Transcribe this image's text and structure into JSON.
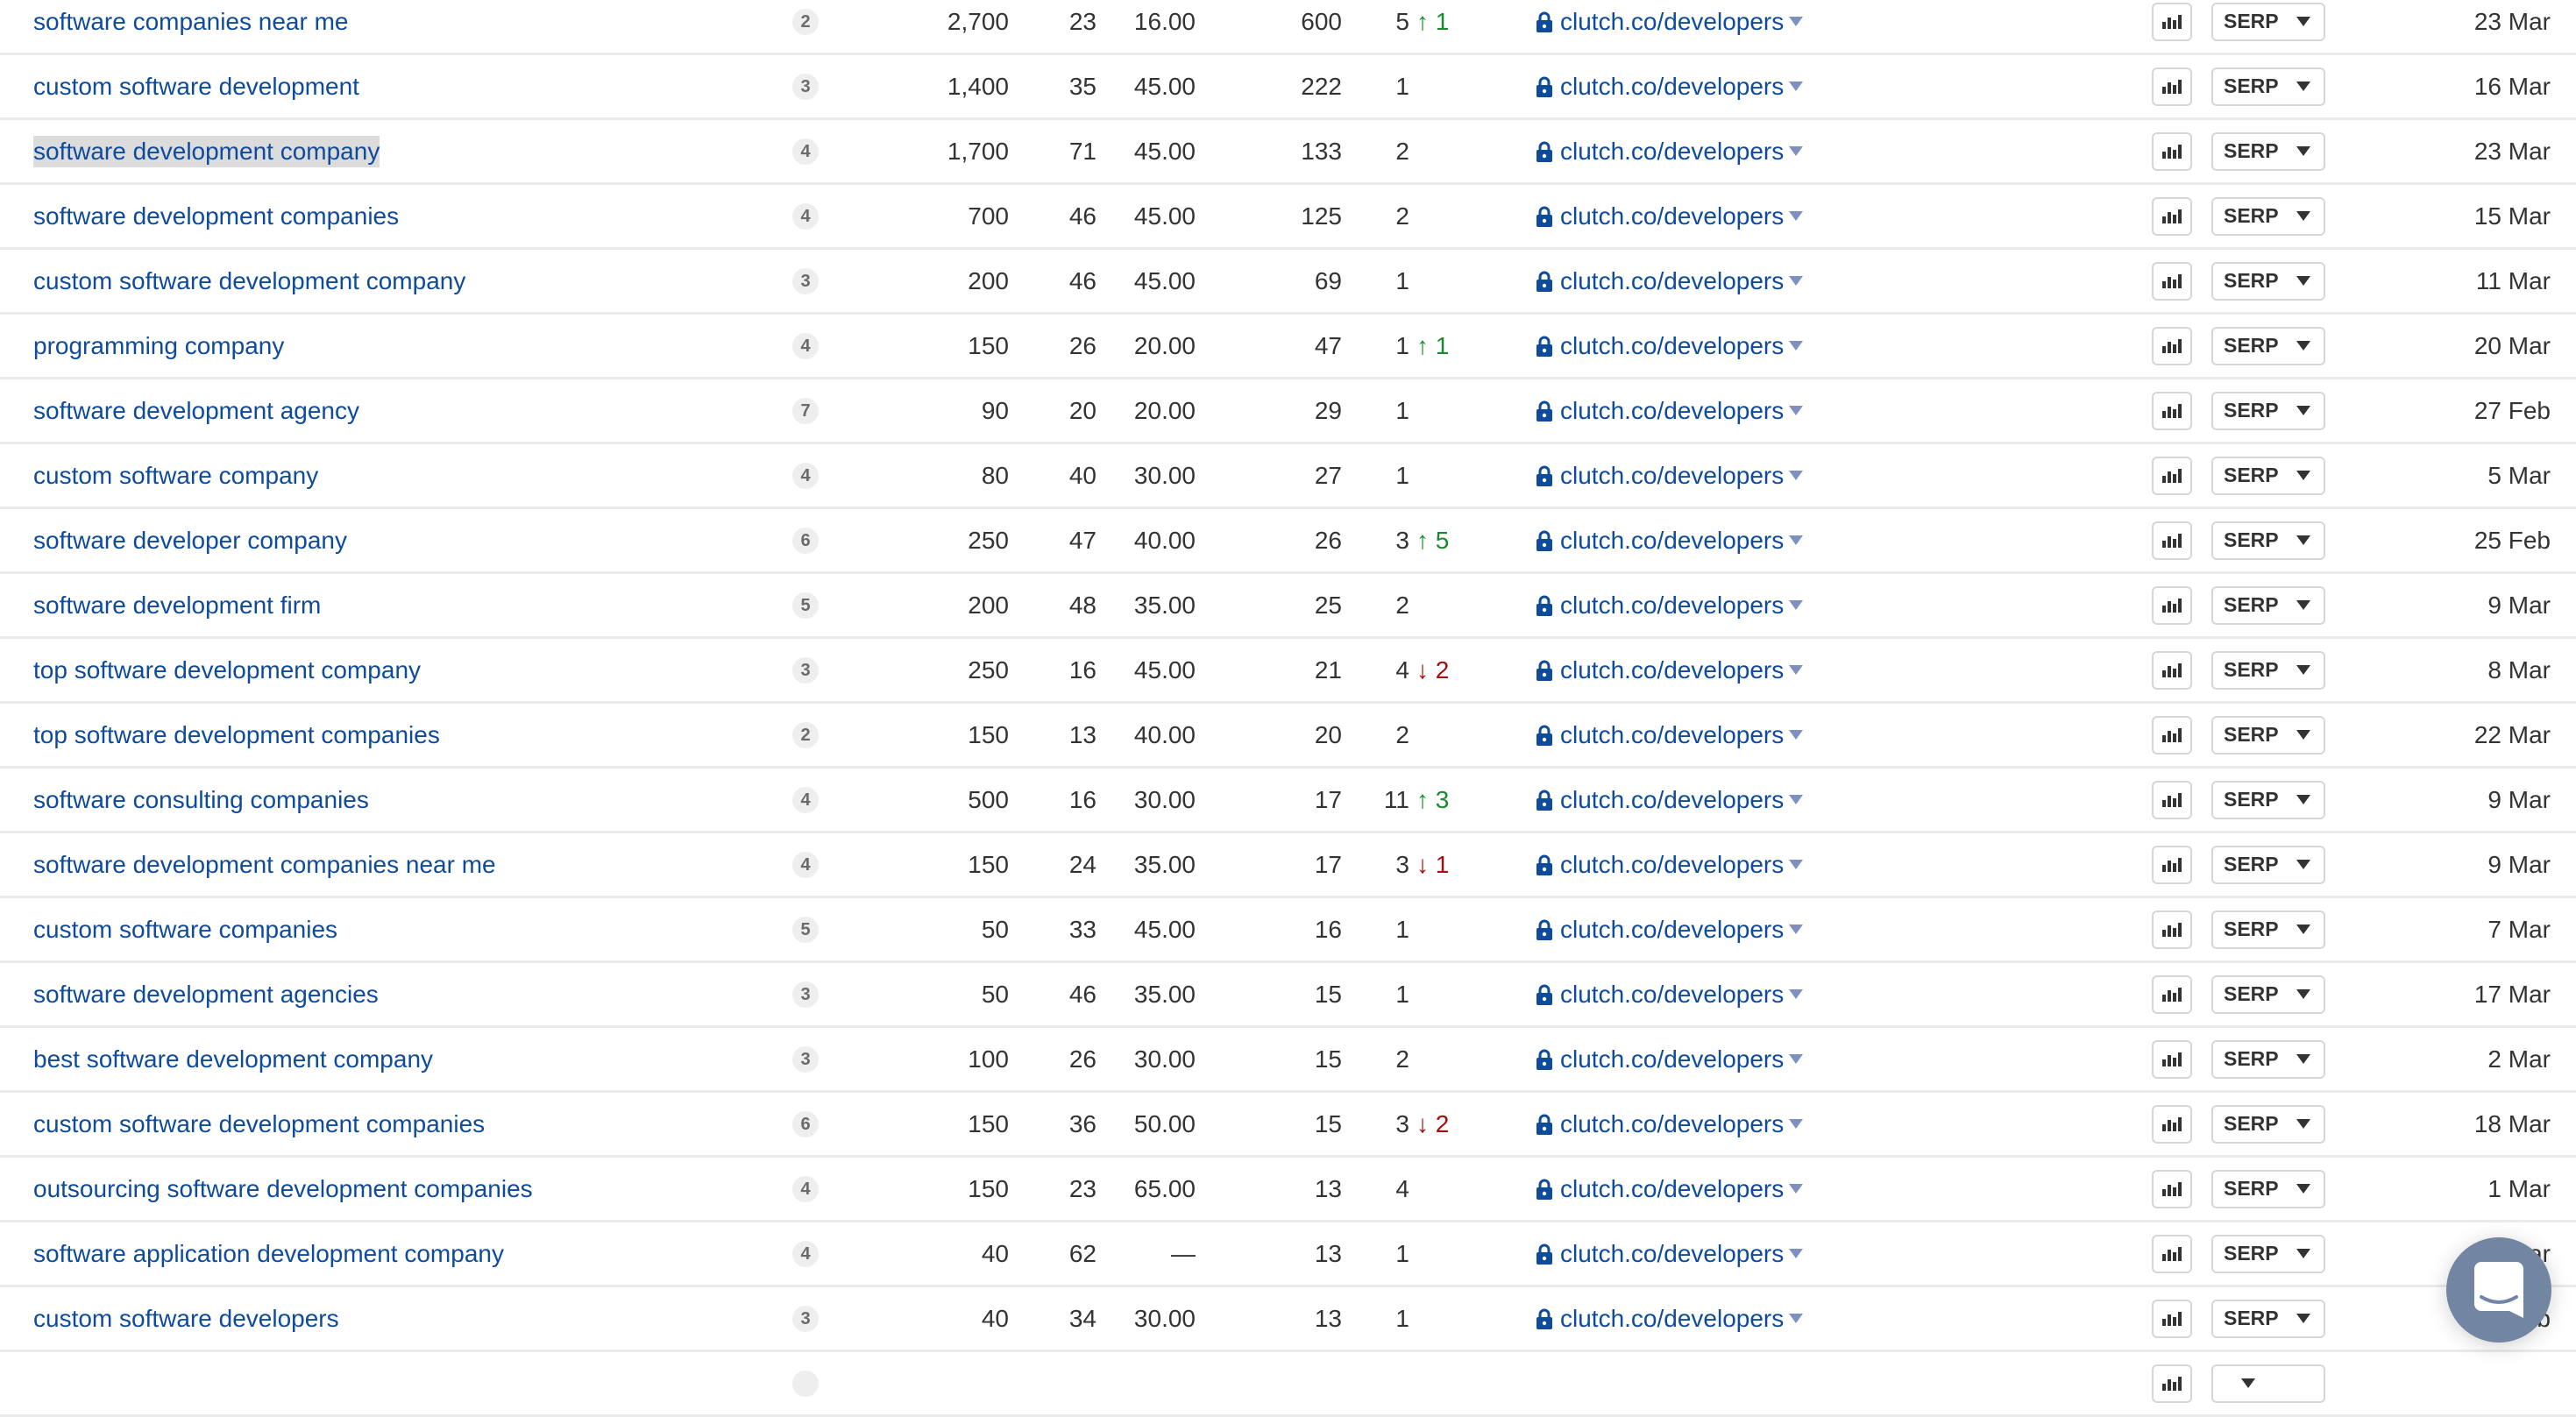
{
  "rows": [
    {
      "keyword": "software companies near me",
      "words": "2",
      "volume": "2,700",
      "kd": "23",
      "cpc": "16.00",
      "traffic": "600",
      "position": "5",
      "change": "1",
      "change_dir": "up",
      "url": "clutch.co/developers",
      "serp_label": "SERP",
      "updated": "23 Mar"
    },
    {
      "keyword": "custom software development",
      "words": "3",
      "volume": "1,400",
      "kd": "35",
      "cpc": "45.00",
      "traffic": "222",
      "position": "1",
      "change": "",
      "change_dir": "",
      "url": "clutch.co/developers",
      "serp_label": "SERP",
      "updated": "16 Mar"
    },
    {
      "keyword": "software development company",
      "words": "4",
      "volume": "1,700",
      "kd": "71",
      "cpc": "45.00",
      "traffic": "133",
      "position": "2",
      "change": "",
      "change_dir": "",
      "url": "clutch.co/developers",
      "serp_label": "SERP",
      "updated": "23 Mar",
      "selected": true
    },
    {
      "keyword": "software development companies",
      "words": "4",
      "volume": "700",
      "kd": "46",
      "cpc": "45.00",
      "traffic": "125",
      "position": "2",
      "change": "",
      "change_dir": "",
      "url": "clutch.co/developers",
      "serp_label": "SERP",
      "updated": "15 Mar"
    },
    {
      "keyword": "custom software development company",
      "words": "3",
      "volume": "200",
      "kd": "46",
      "cpc": "45.00",
      "traffic": "69",
      "position": "1",
      "change": "",
      "change_dir": "",
      "url": "clutch.co/developers",
      "serp_label": "SERP",
      "updated": "11 Mar"
    },
    {
      "keyword": "programming company",
      "words": "4",
      "volume": "150",
      "kd": "26",
      "cpc": "20.00",
      "traffic": "47",
      "position": "1",
      "change": "1",
      "change_dir": "up",
      "url": "clutch.co/developers",
      "serp_label": "SERP",
      "updated": "20 Mar"
    },
    {
      "keyword": "software development agency",
      "words": "7",
      "volume": "90",
      "kd": "20",
      "cpc": "20.00",
      "traffic": "29",
      "position": "1",
      "change": "",
      "change_dir": "",
      "url": "clutch.co/developers",
      "serp_label": "SERP",
      "updated": "27 Feb"
    },
    {
      "keyword": "custom software company",
      "words": "4",
      "volume": "80",
      "kd": "40",
      "cpc": "30.00",
      "traffic": "27",
      "position": "1",
      "change": "",
      "change_dir": "",
      "url": "clutch.co/developers",
      "serp_label": "SERP",
      "updated": "5 Mar"
    },
    {
      "keyword": "software developer company",
      "words": "6",
      "volume": "250",
      "kd": "47",
      "cpc": "40.00",
      "traffic": "26",
      "position": "3",
      "change": "5",
      "change_dir": "up",
      "url": "clutch.co/developers",
      "serp_label": "SERP",
      "updated": "25 Feb"
    },
    {
      "keyword": "software development firm",
      "words": "5",
      "volume": "200",
      "kd": "48",
      "cpc": "35.00",
      "traffic": "25",
      "position": "2",
      "change": "",
      "change_dir": "",
      "url": "clutch.co/developers",
      "serp_label": "SERP",
      "updated": "9 Mar"
    },
    {
      "keyword": "top software development company",
      "words": "3",
      "volume": "250",
      "kd": "16",
      "cpc": "45.00",
      "traffic": "21",
      "position": "4",
      "change": "2",
      "change_dir": "down",
      "url": "clutch.co/developers",
      "serp_label": "SERP",
      "updated": "8 Mar"
    },
    {
      "keyword": "top software development companies",
      "words": "2",
      "volume": "150",
      "kd": "13",
      "cpc": "40.00",
      "traffic": "20",
      "position": "2",
      "change": "",
      "change_dir": "",
      "url": "clutch.co/developers",
      "serp_label": "SERP",
      "updated": "22 Mar"
    },
    {
      "keyword": "software consulting companies",
      "words": "4",
      "volume": "500",
      "kd": "16",
      "cpc": "30.00",
      "traffic": "17",
      "position": "11",
      "change": "3",
      "change_dir": "up",
      "url": "clutch.co/developers",
      "serp_label": "SERP",
      "updated": "9 Mar"
    },
    {
      "keyword": "software development companies near me",
      "words": "4",
      "volume": "150",
      "kd": "24",
      "cpc": "35.00",
      "traffic": "17",
      "position": "3",
      "change": "1",
      "change_dir": "down",
      "url": "clutch.co/developers",
      "serp_label": "SERP",
      "updated": "9 Mar"
    },
    {
      "keyword": "custom software companies",
      "words": "5",
      "volume": "50",
      "kd": "33",
      "cpc": "45.00",
      "traffic": "16",
      "position": "1",
      "change": "",
      "change_dir": "",
      "url": "clutch.co/developers",
      "serp_label": "SERP",
      "updated": "7 Mar"
    },
    {
      "keyword": "software development agencies",
      "words": "3",
      "volume": "50",
      "kd": "46",
      "cpc": "35.00",
      "traffic": "15",
      "position": "1",
      "change": "",
      "change_dir": "",
      "url": "clutch.co/developers",
      "serp_label": "SERP",
      "updated": "17 Mar"
    },
    {
      "keyword": "best software development company",
      "words": "3",
      "volume": "100",
      "kd": "26",
      "cpc": "30.00",
      "traffic": "15",
      "position": "2",
      "change": "",
      "change_dir": "",
      "url": "clutch.co/developers",
      "serp_label": "SERP",
      "updated": "2 Mar"
    },
    {
      "keyword": "custom software development companies",
      "words": "6",
      "volume": "150",
      "kd": "36",
      "cpc": "50.00",
      "traffic": "15",
      "position": "3",
      "change": "2",
      "change_dir": "down",
      "url": "clutch.co/developers",
      "serp_label": "SERP",
      "updated": "18 Mar"
    },
    {
      "keyword": "outsourcing software development companies",
      "words": "4",
      "volume": "150",
      "kd": "23",
      "cpc": "65.00",
      "traffic": "13",
      "position": "4",
      "change": "",
      "change_dir": "",
      "url": "clutch.co/developers",
      "serp_label": "SERP",
      "updated": "1 Mar"
    },
    {
      "keyword": "software application development company",
      "words": "4",
      "volume": "40",
      "kd": "62",
      "cpc": "—",
      "traffic": "13",
      "position": "1",
      "change": "",
      "change_dir": "",
      "url": "clutch.co/developers",
      "serp_label": "SERP",
      "updated": "…ar"
    },
    {
      "keyword": "custom software developers",
      "words": "3",
      "volume": "40",
      "kd": "34",
      "cpc": "30.00",
      "traffic": "13",
      "position": "1",
      "change": "",
      "change_dir": "",
      "url": "clutch.co/developers",
      "serp_label": "SERP",
      "updated": "…b"
    },
    {
      "keyword": "",
      "words": "",
      "volume": "",
      "kd": "",
      "cpc": "",
      "traffic": "",
      "position": "",
      "change": "",
      "change_dir": "",
      "url": "",
      "serp_label": "",
      "updated": "",
      "partial": true
    }
  ],
  "icons": {
    "change_up": "↑",
    "change_down": "↓",
    "lock": "lock-icon",
    "chart": "bar-chart-icon",
    "chat": "chat-icon"
  },
  "colors": {
    "link": "#0e4b9c",
    "up": "#1a8a2e",
    "down": "#a30e0e",
    "chat_widget": "#7285a3"
  }
}
